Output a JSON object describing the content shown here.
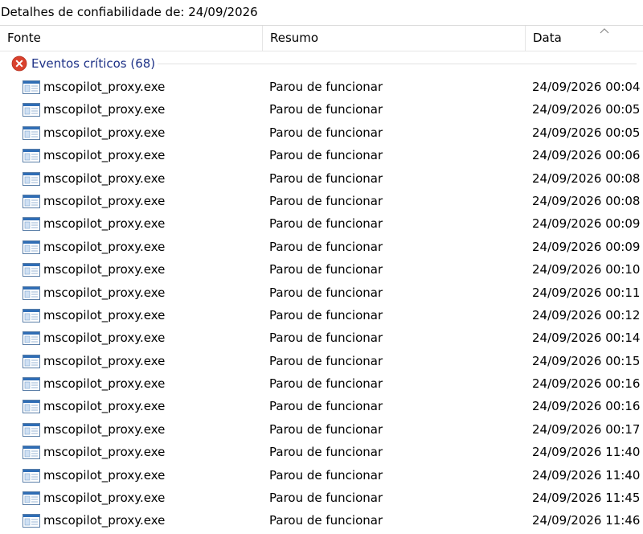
{
  "title": "Detalhes de confiabilidade de: 24/09/2026",
  "columns": {
    "fonte": "Fonte",
    "resumo": "Resumo",
    "data": "Data"
  },
  "group": {
    "label": "Eventos críticos (68)",
    "icon": "error-icon",
    "color": "#1e3287"
  },
  "rows": [
    {
      "source": "mscopilot_proxy.exe",
      "summary": "Parou de funcionar",
      "date": "24/09/2026 00:04"
    },
    {
      "source": "mscopilot_proxy.exe",
      "summary": "Parou de funcionar",
      "date": "24/09/2026 00:05"
    },
    {
      "source": "mscopilot_proxy.exe",
      "summary": "Parou de funcionar",
      "date": "24/09/2026 00:05"
    },
    {
      "source": "mscopilot_proxy.exe",
      "summary": "Parou de funcionar",
      "date": "24/09/2026 00:06"
    },
    {
      "source": "mscopilot_proxy.exe",
      "summary": "Parou de funcionar",
      "date": "24/09/2026 00:08"
    },
    {
      "source": "mscopilot_proxy.exe",
      "summary": "Parou de funcionar",
      "date": "24/09/2026 00:08"
    },
    {
      "source": "mscopilot_proxy.exe",
      "summary": "Parou de funcionar",
      "date": "24/09/2026 00:09"
    },
    {
      "source": "mscopilot_proxy.exe",
      "summary": "Parou de funcionar",
      "date": "24/09/2026 00:09"
    },
    {
      "source": "mscopilot_proxy.exe",
      "summary": "Parou de funcionar",
      "date": "24/09/2026 00:10"
    },
    {
      "source": "mscopilot_proxy.exe",
      "summary": "Parou de funcionar",
      "date": "24/09/2026 00:11"
    },
    {
      "source": "mscopilot_proxy.exe",
      "summary": "Parou de funcionar",
      "date": "24/09/2026 00:12"
    },
    {
      "source": "mscopilot_proxy.exe",
      "summary": "Parou de funcionar",
      "date": "24/09/2026 00:14"
    },
    {
      "source": "mscopilot_proxy.exe",
      "summary": "Parou de funcionar",
      "date": "24/09/2026 00:15"
    },
    {
      "source": "mscopilot_proxy.exe",
      "summary": "Parou de funcionar",
      "date": "24/09/2026 00:16"
    },
    {
      "source": "mscopilot_proxy.exe",
      "summary": "Parou de funcionar",
      "date": "24/09/2026 00:16"
    },
    {
      "source": "mscopilot_proxy.exe",
      "summary": "Parou de funcionar",
      "date": "24/09/2026 00:17"
    },
    {
      "source": "mscopilot_proxy.exe",
      "summary": "Parou de funcionar",
      "date": "24/09/2026 11:40"
    },
    {
      "source": "mscopilot_proxy.exe",
      "summary": "Parou de funcionar",
      "date": "24/09/2026 11:40"
    },
    {
      "source": "mscopilot_proxy.exe",
      "summary": "Parou de funcionar",
      "date": "24/09/2026 11:45"
    },
    {
      "source": "mscopilot_proxy.exe",
      "summary": "Parou de funcionar",
      "date": "24/09/2026 11:46"
    }
  ],
  "row_icon": "application-window-icon"
}
